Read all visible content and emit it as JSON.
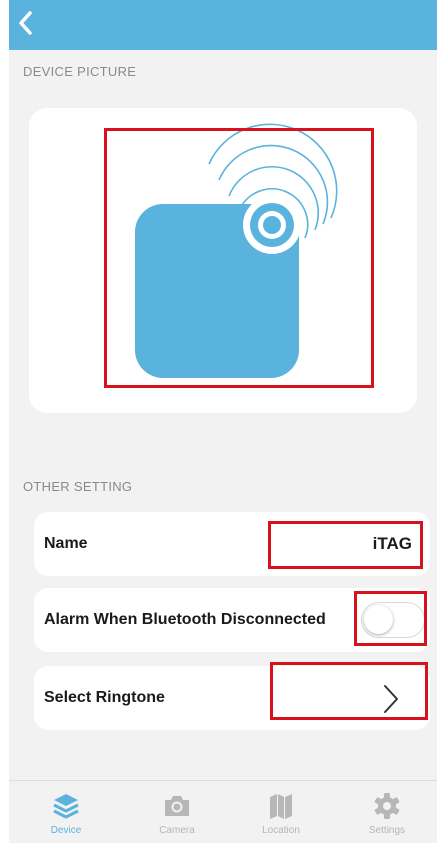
{
  "header": {
    "back_icon": "chevron-left-icon"
  },
  "device_picture": {
    "section_label": "DEVICE PICTURE",
    "image": "itag-bluetooth-device"
  },
  "other_setting": {
    "section_label": "OTHER SETTING",
    "name": {
      "label": "Name",
      "value": "iTAG"
    },
    "alarm": {
      "label": "Alarm When Bluetooth Disconnected",
      "enabled": false
    },
    "ringtone": {
      "label": "Select Ringtone",
      "icon": "chevron-right-icon"
    }
  },
  "tabbar": {
    "tabs": [
      {
        "label": "Device",
        "icon": "layers-icon",
        "active": true
      },
      {
        "label": "Camera",
        "icon": "camera-icon",
        "active": false
      },
      {
        "label": "Location",
        "icon": "map-icon",
        "active": false
      },
      {
        "label": "Settings",
        "icon": "gear-icon",
        "active": false
      }
    ]
  },
  "colors": {
    "accent": "#5ab3dc",
    "highlight": "#d7121c",
    "background": "#f2f2f2"
  }
}
